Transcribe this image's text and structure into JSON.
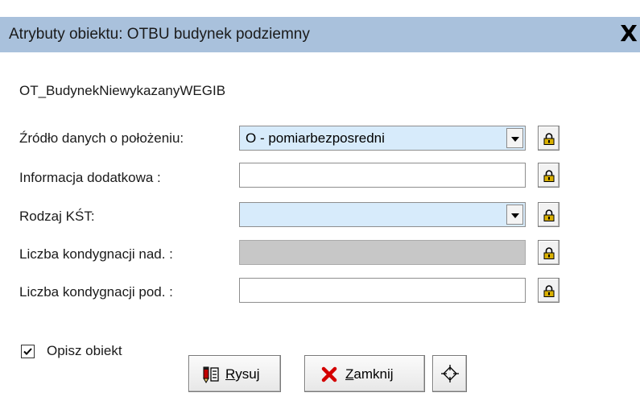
{
  "window": {
    "title": "Atrybuty obiektu: OTBU budynek podziemny",
    "close_label": "X"
  },
  "object_class": "OT_BudynekNiewykazanyWEGIB",
  "fields": [
    {
      "label": "Źródło danych o położeniu:",
      "value": "O - pomiarbezposredni",
      "type": "combo",
      "lock_icon": "lock-icon"
    },
    {
      "label": "Informacja dodatkowa :",
      "value": "",
      "type": "text",
      "lock_icon": "lock-icon"
    },
    {
      "label": "Rodzaj KŚT:",
      "value": "",
      "type": "combo",
      "lock_icon": "lock-icon"
    },
    {
      "label": "Liczba kondygnacji nad. :",
      "value": "",
      "type": "text-disabled",
      "lock_icon": "lock-icon"
    },
    {
      "label": "Liczba kondygnacji pod. :",
      "value": "",
      "type": "text",
      "lock_icon": "lock-icon"
    }
  ],
  "describe_checkbox": {
    "label": "Opisz obiekt",
    "checked": true
  },
  "buttons": {
    "draw": {
      "mnemonic": "R",
      "rest": "ysuj",
      "icon": "draw-icon"
    },
    "close": {
      "mnemonic": "Z",
      "rest": "amknij",
      "icon": "red-x-icon"
    },
    "locate": {
      "icon": "crosshair-icon"
    }
  },
  "colors": {
    "titlebar": "#a9c1dc",
    "combo_bg": "#d7ebfb",
    "disabled_bg": "#c7c7c7",
    "lock_gold": "#d9b000",
    "close_red": "#d40000"
  }
}
